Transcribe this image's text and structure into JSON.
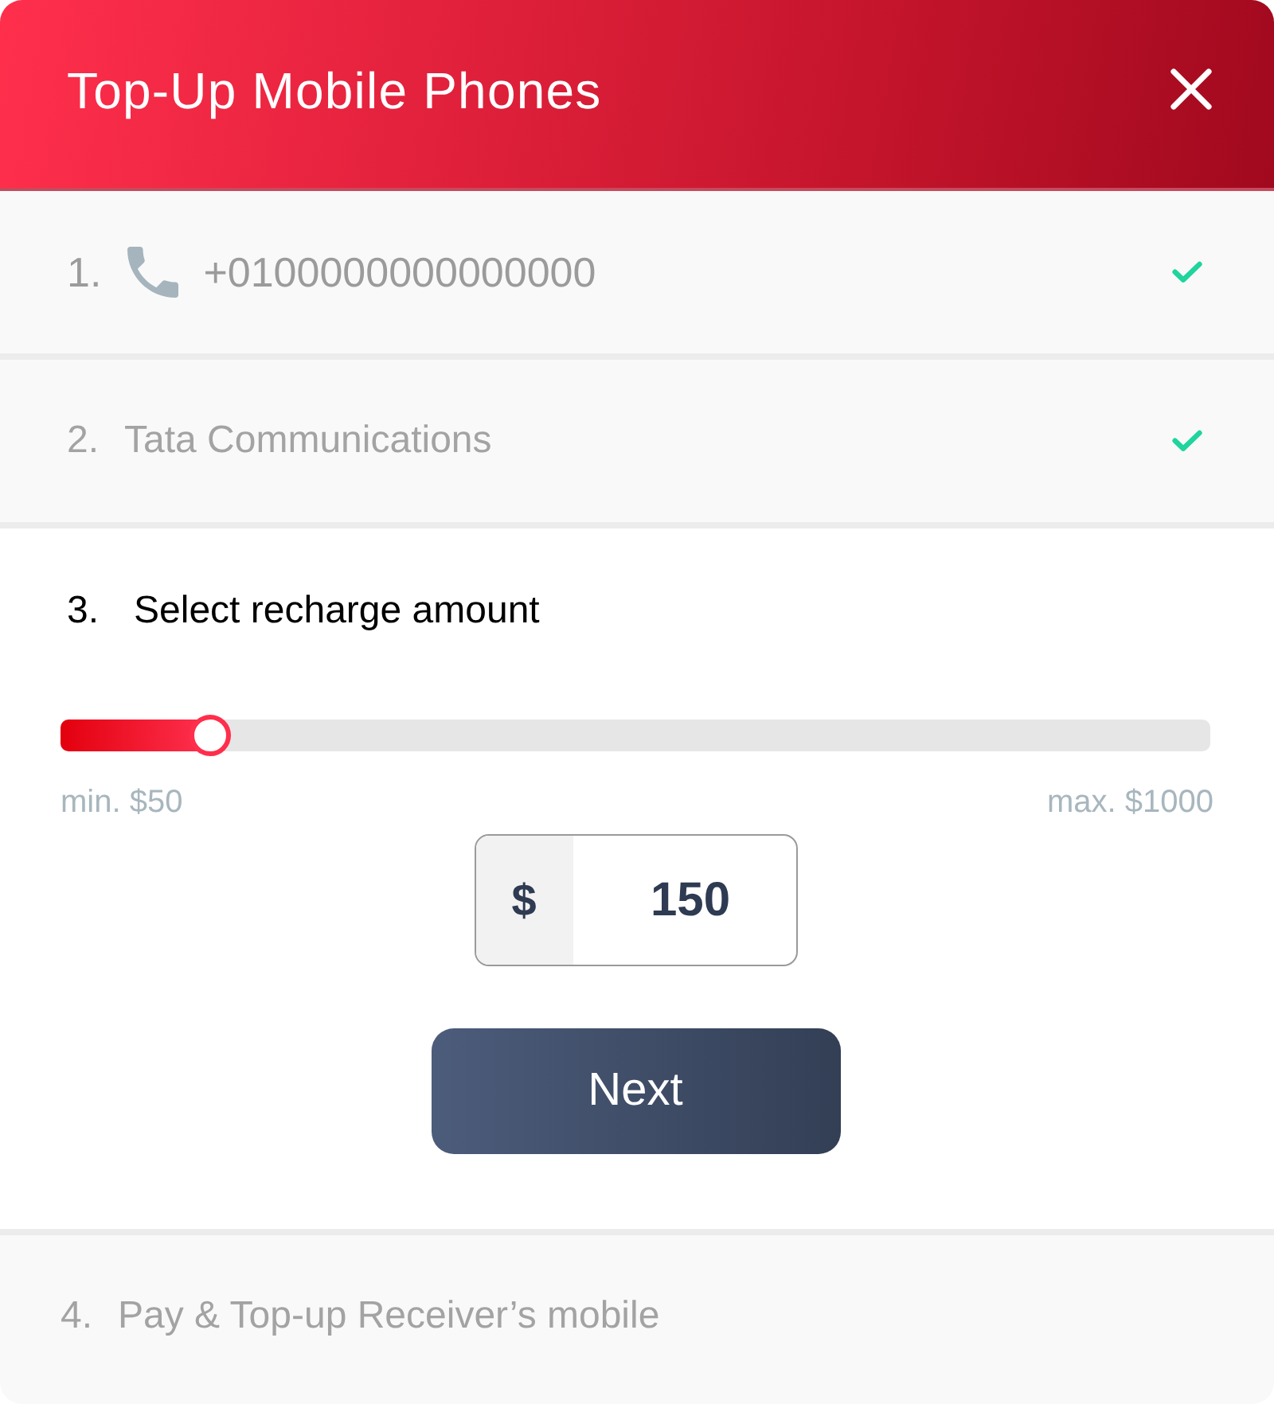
{
  "dialog": {
    "title": "Top-Up Mobile Phones"
  },
  "steps": [
    {
      "number": "1.",
      "kind": "phone",
      "label": "+0100000000000000",
      "completed": true,
      "expanded": false
    },
    {
      "number": "2.",
      "kind": "plain",
      "label": "Tata Communications",
      "completed": true,
      "expanded": false
    },
    {
      "number": "3.",
      "kind": "plain",
      "label": "Select recharge amount",
      "completed": false,
      "expanded": true,
      "content": {
        "slider": {
          "level": 0.13,
          "min_label": "min. $50",
          "max_label": "max. $1000"
        },
        "amount": {
          "currency": "$",
          "value": "150"
        },
        "next_button": "Next"
      }
    },
    {
      "number": "4.",
      "kind": "plain",
      "label": "Pay & Top-up Receiver’s mobile",
      "completed": false,
      "expanded": false
    }
  ]
}
